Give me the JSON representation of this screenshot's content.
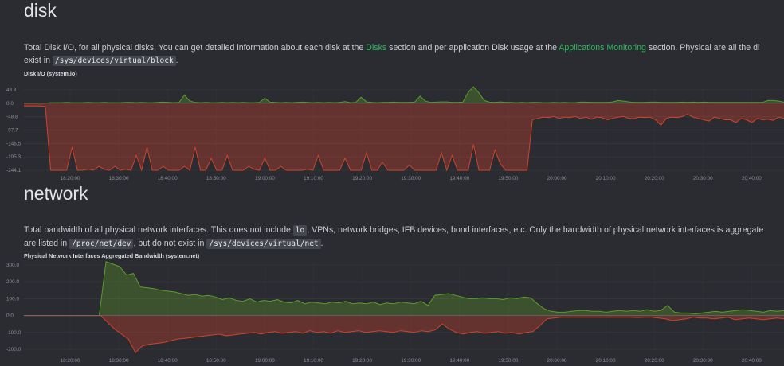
{
  "disk": {
    "title": "disk",
    "desc": {
      "p1": "Total Disk I/O, for all physical disks. You can get detailed information about each disk at the ",
      "link1": "Disks",
      "p2": " section and per application Disk usage at the ",
      "link2": "Applications Monitoring",
      "p3": " section. Physical are all the di",
      "p4": "exist in ",
      "code1": "/sys/devices/virtual/block",
      "p5": "."
    },
    "chart_title": "Disk I/O (system.io)"
  },
  "network": {
    "title": "network",
    "desc": {
      "p1": "Total bandwidth of all physical network interfaces. This does not include ",
      "code1": "lo",
      "p2": ", VPNs, network bridges, IFB devices, bond interfaces, etc. Only the bandwidth of physical network interfaces is aggregate",
      "p3": "are listed in ",
      "code2": "/proc/net/dev",
      "p4": ", but do not exist in ",
      "code3": "/sys/devices/virtual/net",
      "p5": "."
    },
    "chart_title": "Physical Network Interfaces Aggregated Bandwidth (system.net)"
  },
  "chart_data": [
    {
      "type": "area",
      "title": "Disk I/O (system.io)",
      "x": [
        "18:20:00",
        "18:30:00",
        "18:40:00",
        "18:50:00",
        "19:00:00",
        "19:10:00",
        "19:20:00",
        "19:30:00",
        "19:40:00",
        "19:50:00",
        "20:00:00",
        "20:10:00",
        "20:20:00",
        "20:30:00",
        "20:40:00"
      ],
      "y_ticks": [
        "48.8",
        "0.0",
        "-48.8",
        "-97.7",
        "-146.5",
        "-195.3",
        "-244.1"
      ],
      "ylim": [
        -244.1,
        48.8
      ],
      "series": [
        {
          "color": "#5e9b2a",
          "values": [
            0,
            0,
            0,
            0,
            0.5,
            2,
            2,
            2,
            3,
            2,
            2,
            2,
            3,
            2,
            2,
            3,
            2,
            2,
            2,
            3,
            3,
            2,
            3,
            2,
            2,
            3,
            4,
            3,
            2,
            3,
            30,
            8,
            3,
            2,
            3,
            2,
            2,
            3,
            2,
            3,
            2,
            3,
            2,
            2,
            3,
            18,
            4,
            3,
            2,
            3,
            2,
            3,
            4,
            3,
            2,
            3,
            2,
            3,
            2,
            3,
            6,
            2,
            3,
            22,
            5,
            3,
            2,
            3,
            3,
            4,
            3,
            3,
            3,
            4,
            26,
            8,
            3,
            4,
            5,
            5,
            3,
            3,
            4,
            40,
            60,
            38,
            10,
            4,
            3,
            5,
            3,
            3,
            2,
            3,
            2,
            3,
            3,
            2,
            2,
            3,
            2,
            3,
            2,
            2,
            4,
            4,
            3,
            3,
            3,
            3,
            5,
            10,
            8,
            5,
            3,
            3,
            3,
            4,
            4,
            3,
            3,
            3,
            3,
            4,
            3,
            4,
            3,
            4,
            3,
            3,
            3,
            3,
            3,
            3,
            3,
            3,
            3,
            3,
            3,
            10,
            10,
            8,
            4
          ]
        },
        {
          "color": "#d1432a",
          "values": [
            -10,
            -10,
            -10,
            -10,
            -12,
            -244,
            -244,
            -244,
            -244,
            -160,
            -244,
            -244,
            -240,
            -244,
            -230,
            -240,
            -244,
            -230,
            -244,
            -240,
            -244,
            -190,
            -244,
            -160,
            -244,
            -244,
            -230,
            -244,
            -244,
            -244,
            -230,
            -244,
            -160,
            -244,
            -244,
            -200,
            -244,
            -244,
            -190,
            -244,
            -244,
            -244,
            -230,
            -240,
            -244,
            -200,
            -244,
            -244,
            -230,
            -244,
            -244,
            -244,
            -244,
            -240,
            -244,
            -190,
            -244,
            -244,
            -244,
            -244,
            -200,
            -244,
            -244,
            -244,
            -180,
            -244,
            -244,
            -215,
            -244,
            -244,
            -244,
            -244,
            -225,
            -244,
            -244,
            -244,
            -244,
            -244,
            -180,
            -244,
            -190,
            -244,
            -244,
            -244,
            -150,
            -244,
            -244,
            -244,
            -170,
            -220,
            -244,
            -244,
            -244,
            -244,
            -244,
            -60,
            -55,
            -50,
            -52,
            -48,
            -55,
            -50,
            -52,
            -48,
            -55,
            -50,
            -58,
            -50,
            -52,
            -60,
            -55,
            -50,
            -48,
            -55,
            -56,
            -50,
            -52,
            -50,
            -60,
            -80,
            -55,
            -50,
            -52,
            -48,
            -40,
            -50,
            -55,
            -60,
            -65,
            -50,
            -55,
            -60,
            -60,
            -70,
            -55,
            -60,
            -70,
            -55,
            -60,
            -58,
            -62,
            -50,
            -55
          ]
        }
      ]
    },
    {
      "type": "area",
      "title": "Physical Network Interfaces Aggregated Bandwidth (system.net)",
      "x": [
        "18:20:00",
        "18:30:00",
        "18:40:00",
        "18:50:00",
        "19:00:00",
        "19:10:00",
        "19:20:00",
        "19:30:00",
        "19:40:00",
        "19:50:00",
        "20:00:00",
        "20:10:00",
        "20:20:00",
        "20:30:00",
        "20:40:00"
      ],
      "y_ticks": [
        "300.0",
        "200.0",
        "100.0",
        "0.0",
        "-100.0",
        "-200.0"
      ],
      "ylim": [
        -200,
        300
      ],
      "series": [
        {
          "color": "#5e9b2a",
          "values": [
            0,
            0,
            0,
            0,
            0,
            0,
            0,
            0,
            0,
            0,
            0,
            0,
            320,
            305,
            290,
            240,
            250,
            170,
            165,
            160,
            150,
            145,
            140,
            130,
            120,
            125,
            115,
            120,
            110,
            95,
            105,
            90,
            85,
            100,
            80,
            90,
            85,
            95,
            80,
            75,
            90,
            70,
            80,
            75,
            70,
            80,
            75,
            85,
            70,
            75,
            70,
            80,
            65,
            75,
            70,
            80,
            75,
            70,
            85,
            60,
            120,
            125,
            130,
            120,
            110,
            100,
            100,
            105,
            100,
            100,
            95,
            105,
            100,
            110,
            105,
            70,
            40,
            25,
            20,
            20,
            25,
            30,
            30,
            25,
            25,
            20,
            25,
            30,
            25,
            30,
            25,
            35,
            25,
            30,
            60,
            20,
            15,
            15,
            10,
            15,
            20,
            25,
            20,
            25,
            30,
            35,
            30,
            25,
            20,
            30,
            25,
            30
          ]
        },
        {
          "color": "#d1432a",
          "values": [
            0,
            0,
            0,
            0,
            0,
            0,
            0,
            0,
            0,
            0,
            0,
            0,
            -40,
            -80,
            -110,
            -140,
            -220,
            -180,
            -170,
            -165,
            -160,
            -150,
            -140,
            -135,
            -130,
            -125,
            -120,
            -115,
            -110,
            -120,
            -115,
            -110,
            -105,
            -100,
            -110,
            -100,
            -95,
            -105,
            -100,
            -95,
            -105,
            -90,
            -100,
            -95,
            -105,
            -90,
            -100,
            -95,
            -90,
            -100,
            -95,
            -90,
            -95,
            -100,
            -90,
            -95,
            -100,
            -90,
            -95,
            -85,
            -50,
            -80,
            -100,
            -110,
            -100,
            -95,
            -105,
            -100,
            -95,
            -105,
            -100,
            -110,
            -100,
            -95,
            -60,
            -20,
            -15,
            -10,
            -10,
            -10,
            -10,
            -10,
            -10,
            -10,
            -10,
            -10,
            -10,
            -10,
            -12,
            -10,
            -10,
            -15,
            -20,
            -30,
            -25,
            -20,
            -10,
            -15,
            -15,
            -20,
            -15,
            -10,
            -25,
            -20,
            -15,
            -20,
            -25,
            -20,
            -15,
            -20
          ]
        }
      ]
    }
  ]
}
